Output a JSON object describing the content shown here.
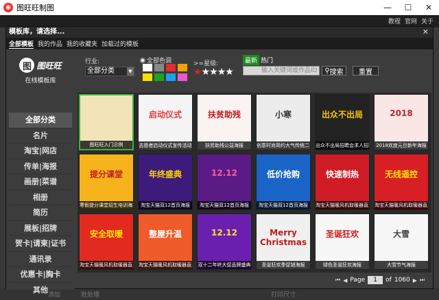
{
  "window": {
    "title": "图旺旺制图",
    "controls": [
      "—",
      "☐",
      "✕"
    ]
  },
  "background": {
    "links": [
      "教程",
      "官网",
      "关于"
    ],
    "footer": [
      "添加",
      "批处理",
      "打印尺寸"
    ]
  },
  "dialog": {
    "title": "模板库，请选择...",
    "close": "✕"
  },
  "tabs": [
    "全部模板",
    "我的作品",
    "我的收藏夹",
    "加载过的模板"
  ],
  "logo": {
    "mark": "图",
    "name": "图旺旺",
    "sub": "在线模板库"
  },
  "sidebar": [
    "全部分类",
    "名片",
    "淘宝|网店",
    "传单|海报",
    "画册|菜谱",
    "相册",
    "简历",
    "展板|招牌",
    "贺卡|请柬|证书",
    "通讯录",
    "优惠卡|胸卡",
    "其他"
  ],
  "filters": {
    "industry_label": "行业:",
    "industry_value": "全部分类",
    "color_label": "全部色调",
    "colors": [
      "#ffffff",
      "#888888",
      "#e52b2b",
      "#f3a200",
      "#f5e200",
      "#1aa51a",
      "#1aa1ee",
      "#e85ad0"
    ],
    "star_label": ">=星级:",
    "stars_on": 1,
    "stars_total": 5,
    "sort_new": "最新",
    "sort_hot": "热门",
    "search_placeholder": "输入关键词或作品ID",
    "search_button": "搜索",
    "reset_button": "重置"
  },
  "templates": [
    {
      "caption": "图旺旺入门示例",
      "title": "",
      "bg": "#f3e3b8",
      "fg": "#444"
    },
    {
      "caption": "志愿者启动仪式宣传活动",
      "title": "启动仪式",
      "bg": "#f4f4f4",
      "fg": "#e23c3c"
    },
    {
      "caption": "扶贫助残公益海报",
      "title": "扶贫助残",
      "bg": "#fbf2f2",
      "fg": "#c61a1a"
    },
    {
      "caption": "创意时尚简约大气传统二十四节气小寒",
      "title": "小寒",
      "bg": "#ececec",
      "fg": "#333"
    },
    {
      "caption": "出众不出局招聘会求人招聘",
      "title": "出众不出局",
      "bg": "#222222",
      "fg": "#f6c400"
    },
    {
      "caption": "2018欢度元旦新年海报",
      "title": "2018",
      "bg": "#fbe6e6",
      "fg": "#c42424"
    },
    {
      "caption": "寒假提分课堂招生培训海报",
      "title": "提分课堂",
      "bg": "#f7b31b",
      "fg": "#c01d1d"
    },
    {
      "caption": "淘宝天猫双12首页海报",
      "title": "年终盛典",
      "bg": "#3d1b7a",
      "fg": "#ffd400"
    },
    {
      "caption": "淘宝天猫双12首页海报",
      "title": "12.12",
      "bg": "#5a1b86",
      "fg": "#ff5b9e"
    },
    {
      "caption": "淘宝天猫双12首页海报",
      "title": "低价抢购",
      "bg": "#1a64c8",
      "fg": "#ffffff"
    },
    {
      "caption": "淘宝天猫暖风机取暖器直通车",
      "title": "快速制热",
      "bg": "#cf1b25",
      "fg": "#ffffff"
    },
    {
      "caption": "淘宝天猫暖风机取暖器直通车",
      "title": "无线遥控",
      "bg": "#d81f26",
      "fg": "#ffe000"
    },
    {
      "caption": "淘宝天猫暖风机取暖器直通车",
      "title": "安全取暖",
      "bg": "#e22a20",
      "fg": "#ffe000"
    },
    {
      "caption": "淘宝天猫暖风机取暖器直通车",
      "title": "整屋升温",
      "bg": "#ef5b2a",
      "fg": "#ffffff"
    },
    {
      "caption": "双十二年终大促品牌盛典",
      "title": "12.12",
      "bg": "#6b1fae",
      "fg": "#ffde3a"
    },
    {
      "caption": "圣诞狂欢季促销海报",
      "title": "Merry Christmas",
      "bg": "#f0f0f0",
      "fg": "#c01a1a"
    },
    {
      "caption": "绿色圣诞狂欢海报",
      "title": "圣诞狂欢",
      "bg": "#f7f7f7",
      "fg": "#d21b1b"
    },
    {
      "caption": "大雪节气海报",
      "title": "大雪",
      "bg": "#f6f6f6",
      "fg": "#444"
    }
  ],
  "pager": {
    "label": "Page",
    "current": "1",
    "of_label": "of",
    "total": "1060"
  }
}
